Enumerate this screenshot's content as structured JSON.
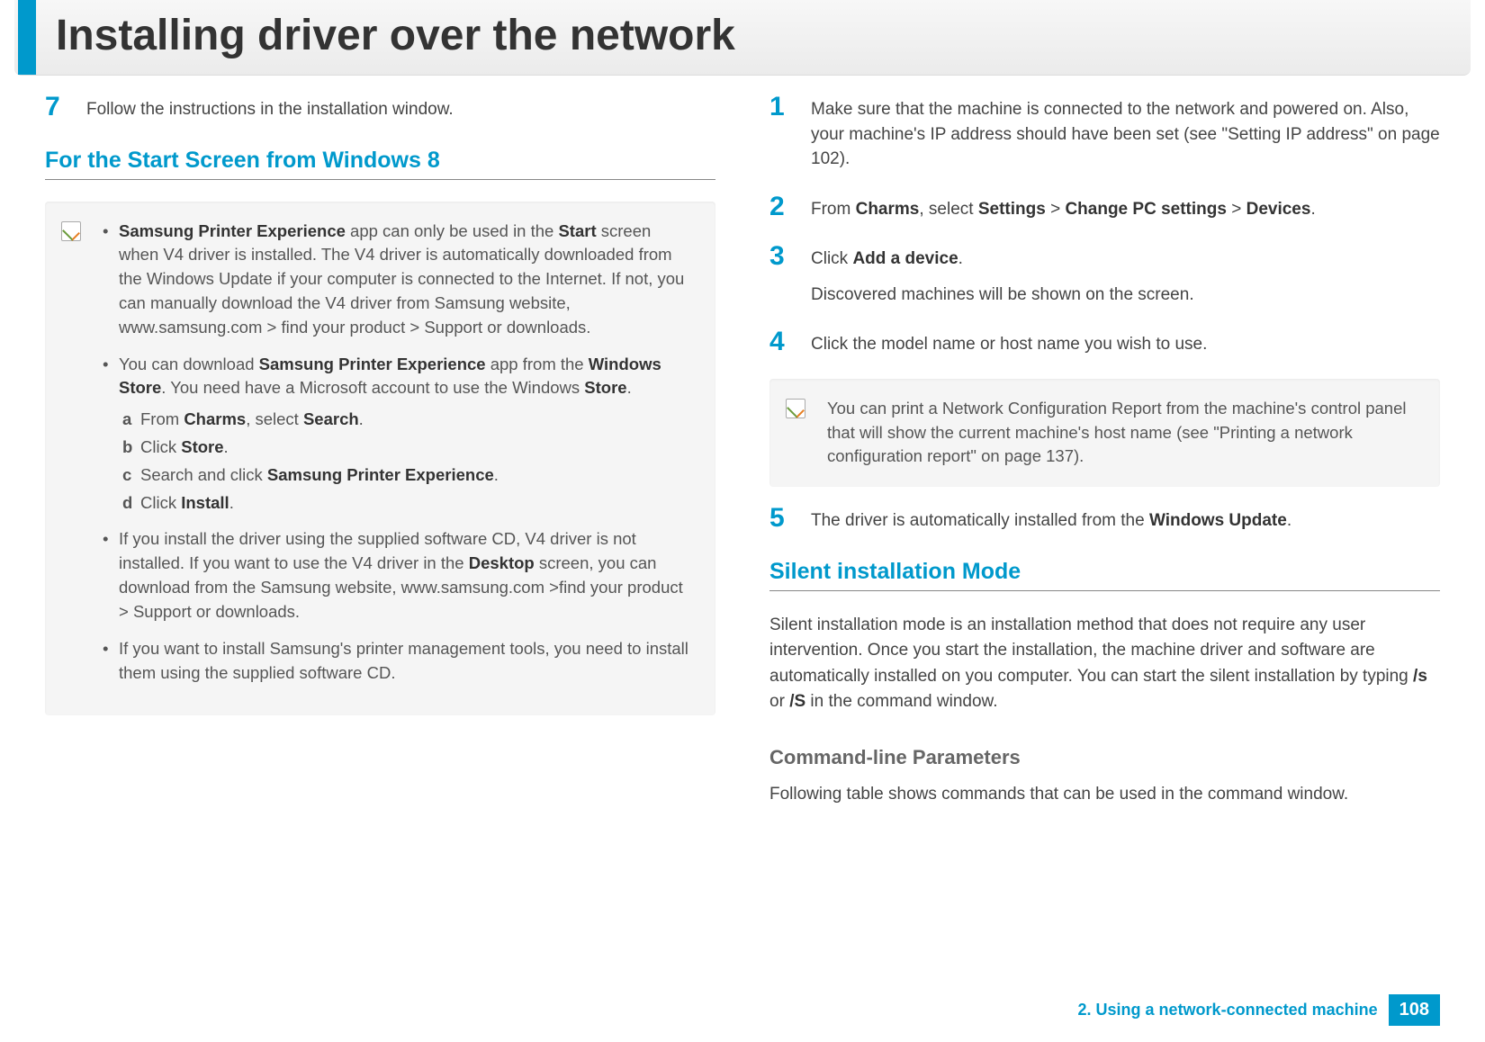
{
  "header": {
    "title": "Installing driver over the network"
  },
  "left": {
    "step7": "Follow the instructions in the installation window.",
    "subheading": "For the Start Screen from Windows 8",
    "note": {
      "b1_prefix": "",
      "b1_spe": "Samsung Printer Experience",
      "b1_mid1": " app can only be used in the ",
      "b1_start": "Start",
      "b1_tail": " screen when V4 driver is installed. The V4 driver is automatically downloaded from the Windows Update if your computer is connected to the Internet. If not, you can manually download the V4 driver from Samsung website, www.samsung.com > find your product > Support or downloads.",
      "b2_pre": "You can download ",
      "b2_spe": "Samsung Printer Experience",
      "b2_mid": " app from the ",
      "b2_ws": "Windows Store",
      "b2_mid2": ". You need have a Microsoft account to use the Windows ",
      "b2_store": "Store",
      "b2_end": ".",
      "sa_pre": "From ",
      "sa_charms": "Charms",
      "sa_mid": ", select ",
      "sa_search": "Search",
      "sa_end": ".",
      "sb_pre": "Click ",
      "sb_store": "Store",
      "sb_end": ".",
      "sc_pre": "Search and click ",
      "sc_spe": "Samsung Printer Experience",
      "sc_end": ".",
      "sd_pre": "Click ",
      "sd_install": "Install",
      "sd_end": ".",
      "b3_pre": "If you install the driver using the supplied software CD, V4 driver is not installed. If you want to use the V4 driver in the ",
      "b3_desktop": "Desktop",
      "b3_tail": " screen, you can download from the Samsung website, www.samsung.com >find your product > Support or downloads.",
      "b4": "If you want to install Samsung's printer management tools, you need to install them using the supplied software CD."
    }
  },
  "right": {
    "step1": "Make sure that the machine is connected to the network and powered on. Also, your machine's IP address should have been set (see \"Setting IP address\" on page 102).",
    "step2_pre": "From ",
    "step2_charms": "Charms",
    "step2_mid1": ", select ",
    "step2_settings": "Settings",
    "step2_gt1": " > ",
    "step2_cpc": "Change PC settings",
    "step2_gt2": " > ",
    "step2_devices": "Devices",
    "step2_end": ".",
    "step3_pre": "Click ",
    "step3_add": "Add a device",
    "step3_end": ".",
    "step3_sub": "Discovered machines will be shown on the screen.",
    "step4": "Click the model name or host name you wish to use.",
    "note2": "You can print a Network Configuration Report from the machine's control panel that will show the current machine's host name (see \"Printing a network configuration report\" on page 137).",
    "step5_pre": "The driver is automatically installed from the ",
    "step5_wu": "Windows Update",
    "step5_end": ".",
    "silent_heading": "Silent installation Mode",
    "silent_p_pre": "Silent installation mode is an installation method that does not require any user intervention. Once you start the installation, the machine driver and software are automatically installed on you computer. You can start the silent installation by typing ",
    "silent_s1": "/s",
    "silent_or": " or ",
    "silent_s2": "/S",
    "silent_tail": " in the command window.",
    "cmd_heading": "Command-line Parameters",
    "cmd_text": "Following table shows commands that can be used in the command window."
  },
  "footer": {
    "chapter": "2.  Using a network-connected machine",
    "page": "108"
  }
}
